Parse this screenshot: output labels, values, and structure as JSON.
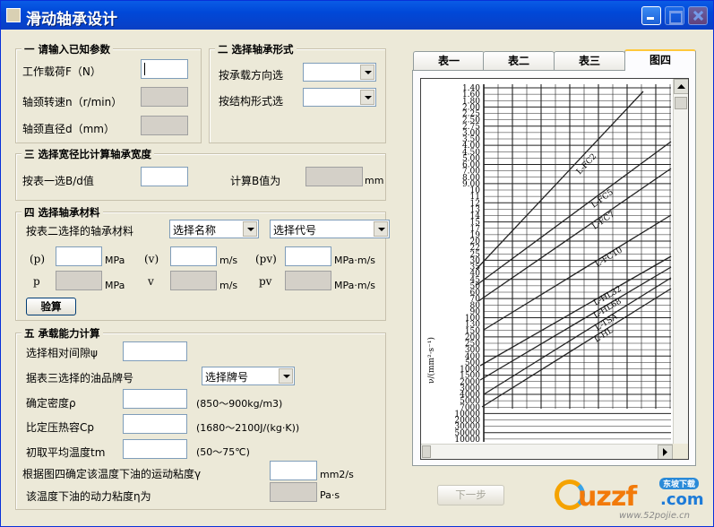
{
  "window": {
    "title": "滑动轴承设计"
  },
  "group1": {
    "title": "一 请输入已知参数",
    "load_label": "工作载荷F（N）",
    "speed_label": "轴颈转速n（r/min）",
    "diameter_label": "轴颈直径d（mm）"
  },
  "group2": {
    "title": "二 选择轴承形式",
    "by_direction_label": "按承载方向选",
    "by_structure_label": "按结构形式选"
  },
  "group3": {
    "title": "三 选择宽径比计算轴承宽度",
    "select_label": "按表一选B/d值",
    "calc_label": "计算B值为",
    "unit": "mm"
  },
  "group4": {
    "title": "四 选择轴承材料",
    "material_label": "按表二选择的轴承材料",
    "name_select": "选择名称",
    "code_select": "选择代号",
    "p_allow": "(p)",
    "v_allow": "(v)",
    "pv_allow": "(pv)",
    "p": "p",
    "v": "v",
    "pv": "pv",
    "unit_mpa": "MPa",
    "unit_ms": "m/s",
    "unit_mpams": "MPa·m/s",
    "check_button": "验算"
  },
  "group5": {
    "title": "五 承载能力计算",
    "clearance_label": "选择相对间隙ψ",
    "oil_label": "据表三选择的油品牌号",
    "oil_select": "选择牌号",
    "density_label": "确定密度ρ",
    "density_range": "(850～900kg/m3)",
    "heat_label": "比定压热容Cp",
    "heat_range": "(1680～2100J/(kg·K))",
    "temp_label": "初取平均温度tm",
    "temp_range": "(50～75℃)",
    "visc_label": "根据图四确定该温度下油的运动粘度γ",
    "visc_unit": "mm2/s",
    "dyn_label": "该温度下油的动力粘度η为",
    "dyn_unit": "Pa·s"
  },
  "tabs": [
    "表一",
    "表二",
    "表三",
    "图四"
  ],
  "chart": {
    "ylabel": "ν/(mm²·s⁻¹)",
    "ticks": [
      "1.40",
      "1.60",
      "1.80",
      "2.00",
      "2.25",
      "2.50",
      "2.75",
      "3.00",
      "3.50",
      "4.00",
      "4.50",
      "5.00",
      "6.00",
      "7.00",
      "8.00",
      "9.00",
      "10",
      "11",
      "12",
      "13",
      "14",
      "15",
      "17",
      "19",
      "20",
      "22",
      "25",
      "30",
      "35",
      "40",
      "45",
      "50",
      "60",
      "70",
      "80",
      "90",
      "100",
      "130",
      "150",
      "200",
      "250",
      "300",
      "400",
      "500",
      "1000",
      "1500",
      "2000",
      "3000",
      "4000",
      "5000",
      "7000",
      "10000",
      "20000",
      "30000",
      "50000",
      "10000"
    ],
    "curve_labels": [
      "L-FC2",
      "L-FC5",
      "L-FC7",
      "L-FC10",
      "L-HL32",
      "L-HL68",
      "L-TSA",
      "L-HL"
    ]
  },
  "next_button": "下一步",
  "watermark": {
    "brand": "uzzf",
    "suffix": ".com",
    "tag": "东坡下载",
    "url": "www.52pojie.cn"
  }
}
